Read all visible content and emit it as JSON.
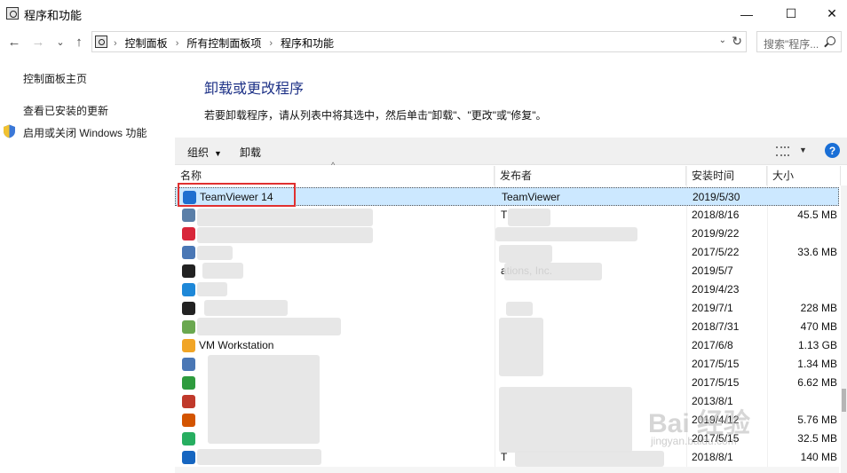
{
  "window": {
    "title": "程序和功能",
    "minimize": "—",
    "maximize": "☐",
    "close": "✕"
  },
  "nav": {
    "back": "←",
    "forward": "→",
    "history": "⌄",
    "up": "↑",
    "breadcrumbs": [
      "控制面板",
      "所有控制面板项",
      "程序和功能"
    ],
    "separator": "›",
    "dropdown": "⌄",
    "refresh": "↻",
    "search_placeholder": "搜索\"程序...",
    "search_icon": "search-icon"
  },
  "sidebar": {
    "items": [
      {
        "label": "控制面板主页"
      },
      {
        "label": "查看已安装的更新"
      },
      {
        "label": "启用或关闭 Windows 功能",
        "icon": "shield-icon"
      }
    ]
  },
  "main": {
    "title": "卸载或更改程序",
    "description": "若要卸载程序，请从列表中将其选中，然后单击\"卸载\"、\"更改\"或\"修复\"。"
  },
  "toolbar": {
    "organize": "组织",
    "uninstall": "卸载",
    "help": "?"
  },
  "columns": {
    "name": "名称",
    "publisher": "发布者",
    "installed_on": "安装时间",
    "size": "大小"
  },
  "rows": [
    {
      "name": "TeamViewer 14",
      "publisher": "TeamViewer",
      "date": "2019/5/30",
      "size": "",
      "icon_color": "#1e6fd0",
      "selected": true
    },
    {
      "name": "",
      "publisher": "T",
      "date": "2018/8/16",
      "size": "45.5 MB",
      "icon_color": "#5b7fa8"
    },
    {
      "name": "",
      "publisher": "",
      "date": "2019/9/22",
      "size": "",
      "icon_color": "#d8263a"
    },
    {
      "name": "",
      "publisher": "",
      "date": "2017/5/22",
      "size": "33.6 MB",
      "icon_color": "#4a77b5"
    },
    {
      "name": "",
      "publisher": "ations, Inc.",
      "date": "2019/5/7",
      "size": "",
      "icon_color": "#222222"
    },
    {
      "name": "",
      "publisher": "",
      "date": "2019/4/23",
      "size": "",
      "icon_color": "#1e88d8"
    },
    {
      "name": "",
      "publisher": "",
      "date": "2019/7/1",
      "size": "228 MB",
      "icon_color": "#222222"
    },
    {
      "name": "",
      "publisher": "",
      "date": "2018/7/31",
      "size": "470 MB",
      "icon_color": "#6aa84f"
    },
    {
      "name": "VM  Workstation",
      "publisher": "",
      "date": "2017/6/8",
      "size": "1.13 GB",
      "icon_color": "#f1a526"
    },
    {
      "name": "",
      "publisher": "",
      "date": "2017/5/15",
      "size": "1.34 MB",
      "icon_color": "#4a77b5"
    },
    {
      "name": "",
      "publisher": "",
      "date": "2017/5/15",
      "size": "6.62 MB",
      "icon_color": "#2e9b3e"
    },
    {
      "name": "",
      "publisher": "",
      "date": "2013/8/1",
      "size": "",
      "icon_color": "#c0392b"
    },
    {
      "name": "",
      "publisher": "",
      "date": "2019/4/12",
      "size": "5.76 MB",
      "icon_color": "#d35400"
    },
    {
      "name": "",
      "publisher": "",
      "date": "2017/5/15",
      "size": "32.5 MB",
      "icon_color": "#27ae60"
    },
    {
      "name": "",
      "publisher": "T",
      "date": "2018/8/1",
      "size": "140 MB",
      "icon_color": "#1565c0"
    }
  ],
  "watermark": {
    "main": "Bai 经验",
    "sub": "jingyan.baidu.com"
  }
}
